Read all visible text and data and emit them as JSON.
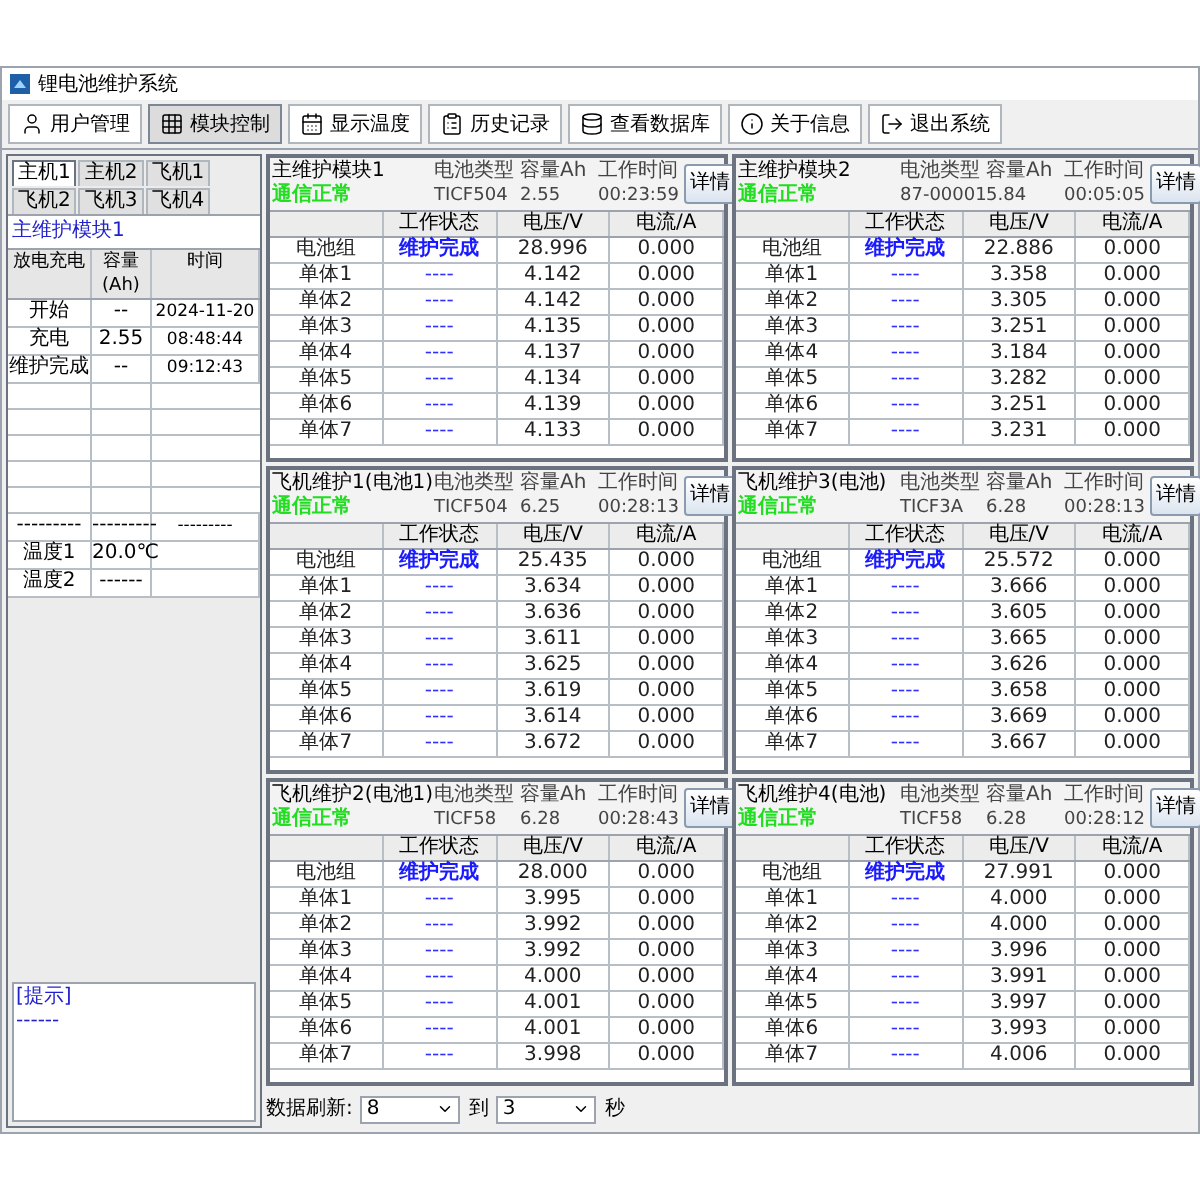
{
  "window": {
    "title": "锂电池维护系统"
  },
  "toolbar": [
    {
      "label": "用户管理",
      "selected": false
    },
    {
      "label": "模块控制",
      "selected": true
    },
    {
      "label": "显示温度",
      "selected": false
    },
    {
      "label": "历史记录",
      "selected": false
    },
    {
      "label": "查看数据库",
      "selected": false
    },
    {
      "label": "关于信息",
      "selected": false
    },
    {
      "label": "退出系统",
      "selected": false
    }
  ],
  "left_panel": {
    "tabs": [
      {
        "label": "主机1",
        "selected": true
      },
      {
        "label": "主机2",
        "selected": false
      },
      {
        "label": "飞机1",
        "selected": false
      },
      {
        "label": "飞机2",
        "selected": false
      },
      {
        "label": "飞机3",
        "selected": false
      },
      {
        "label": "飞机4",
        "selected": false
      }
    ],
    "title": "主维护模块1",
    "columns": [
      "放电充电",
      "容量(Ah)",
      "时间"
    ],
    "rows": [
      {
        "kind": "data",
        "cells": [
          "开始",
          "--",
          "2024-11-20"
        ]
      },
      {
        "kind": "data",
        "cells": [
          "充电",
          "2.55",
          "08:48:44"
        ]
      },
      {
        "kind": "data",
        "cells": [
          "维护完成",
          "--",
          "09:12:43"
        ]
      },
      {
        "kind": "blank"
      },
      {
        "kind": "blank"
      },
      {
        "kind": "blank"
      },
      {
        "kind": "blank"
      },
      {
        "kind": "blank"
      },
      {
        "kind": "data",
        "cells": [
          "---------",
          "---------",
          "---------"
        ]
      },
      {
        "kind": "data",
        "cells": [
          "温度1",
          "20.0℃"
        ]
      },
      {
        "kind": "data",
        "cells": [
          "温度2",
          "------"
        ]
      }
    ],
    "hint": {
      "title": "[提示]",
      "text": "------"
    }
  },
  "modules": [
    {
      "name": "主维护模块1",
      "status": "通信正常",
      "fields": [
        {
          "label": "电池类型",
          "value": "TICF504"
        },
        {
          "label": "容量Ah",
          "value": "2.55"
        },
        {
          "label": "工作时间",
          "value": "00:23:59"
        }
      ],
      "button": "详情",
      "columns": [
        "",
        "工作状态",
        "电压/V",
        "电流/A"
      ],
      "rows": [
        [
          "电池组",
          "维护完成",
          "28.996",
          "0.000"
        ],
        [
          "单体1",
          "----",
          "4.142",
          "0.000"
        ],
        [
          "单体2",
          "----",
          "4.142",
          "0.000"
        ],
        [
          "单体3",
          "----",
          "4.135",
          "0.000"
        ],
        [
          "单体4",
          "----",
          "4.137",
          "0.000"
        ],
        [
          "单体5",
          "----",
          "4.134",
          "0.000"
        ],
        [
          "单体6",
          "----",
          "4.139",
          "0.000"
        ],
        [
          "单体7",
          "----",
          "4.133",
          "0.000"
        ]
      ]
    },
    {
      "name": "主维护模块2",
      "status": "通信正常",
      "fields": [
        {
          "label": "电池类型",
          "value": "87-00001"
        },
        {
          "label": "容量Ah",
          "value": "5.84"
        },
        {
          "label": "工作时间",
          "value": "00:05:05"
        }
      ],
      "button": "详情",
      "columns": [
        "",
        "工作状态",
        "电压/V",
        "电流/A"
      ],
      "rows": [
        [
          "电池组",
          "维护完成",
          "22.886",
          "0.000"
        ],
        [
          "单体1",
          "----",
          "3.358",
          "0.000"
        ],
        [
          "单体2",
          "----",
          "3.305",
          "0.000"
        ],
        [
          "单体3",
          "----",
          "3.251",
          "0.000"
        ],
        [
          "单体4",
          "----",
          "3.184",
          "0.000"
        ],
        [
          "单体5",
          "----",
          "3.282",
          "0.000"
        ],
        [
          "单体6",
          "----",
          "3.251",
          "0.000"
        ],
        [
          "单体7",
          "----",
          "3.231",
          "0.000"
        ]
      ]
    },
    {
      "name": "飞机维护1(电池1)",
      "status": "通信正常",
      "fields": [
        {
          "label": "电池类型",
          "value": "TICF504"
        },
        {
          "label": "容量Ah",
          "value": "6.25"
        },
        {
          "label": "工作时间",
          "value": "00:28:13"
        }
      ],
      "button": "详情",
      "columns": [
        "",
        "工作状态",
        "电压/V",
        "电流/A"
      ],
      "rows": [
        [
          "电池组",
          "维护完成",
          "25.435",
          "0.000"
        ],
        [
          "单体1",
          "----",
          "3.634",
          "0.000"
        ],
        [
          "单体2",
          "----",
          "3.636",
          "0.000"
        ],
        [
          "单体3",
          "----",
          "3.611",
          "0.000"
        ],
        [
          "单体4",
          "----",
          "3.625",
          "0.000"
        ],
        [
          "单体5",
          "----",
          "3.619",
          "0.000"
        ],
        [
          "单体6",
          "----",
          "3.614",
          "0.000"
        ],
        [
          "单体7",
          "----",
          "3.672",
          "0.000"
        ]
      ]
    },
    {
      "name": "飞机维护3(电池)",
      "status": "通信正常",
      "fields": [
        {
          "label": "电池类型",
          "value": "TICF3A"
        },
        {
          "label": "容量Ah",
          "value": "6.28"
        },
        {
          "label": "工作时间",
          "value": "00:28:13"
        }
      ],
      "button": "详情",
      "columns": [
        "",
        "工作状态",
        "电压/V",
        "电流/A"
      ],
      "rows": [
        [
          "电池组",
          "维护完成",
          "25.572",
          "0.000"
        ],
        [
          "单体1",
          "----",
          "3.666",
          "0.000"
        ],
        [
          "单体2",
          "----",
          "3.605",
          "0.000"
        ],
        [
          "单体3",
          "----",
          "3.665",
          "0.000"
        ],
        [
          "单体4",
          "----",
          "3.626",
          "0.000"
        ],
        [
          "单体5",
          "----",
          "3.658",
          "0.000"
        ],
        [
          "单体6",
          "----",
          "3.669",
          "0.000"
        ],
        [
          "单体7",
          "----",
          "3.667",
          "0.000"
        ]
      ]
    },
    {
      "name": "飞机维护2(电池1)",
      "status": "通信正常",
      "fields": [
        {
          "label": "电池类型",
          "value": "TICF58"
        },
        {
          "label": "容量Ah",
          "value": "6.28"
        },
        {
          "label": "工作时间",
          "value": "00:28:43"
        }
      ],
      "button": "详情",
      "columns": [
        "",
        "工作状态",
        "电压/V",
        "电流/A"
      ],
      "rows": [
        [
          "电池组",
          "维护完成",
          "28.000",
          "0.000"
        ],
        [
          "单体1",
          "----",
          "3.995",
          "0.000"
        ],
        [
          "单体2",
          "----",
          "3.992",
          "0.000"
        ],
        [
          "单体3",
          "----",
          "3.992",
          "0.000"
        ],
        [
          "单体4",
          "----",
          "4.000",
          "0.000"
        ],
        [
          "单体5",
          "----",
          "4.001",
          "0.000"
        ],
        [
          "单体6",
          "----",
          "4.001",
          "0.000"
        ],
        [
          "单体7",
          "----",
          "3.998",
          "0.000"
        ]
      ]
    },
    {
      "name": "飞机维护4(电池)",
      "status": "通信正常",
      "fields": [
        {
          "label": "电池类型",
          "value": "TICF58"
        },
        {
          "label": "容量Ah",
          "value": "6.28"
        },
        {
          "label": "工作时间",
          "value": "00:28:12"
        }
      ],
      "button": "详情",
      "columns": [
        "",
        "工作状态",
        "电压/V",
        "电流/A"
      ],
      "rows": [
        [
          "电池组",
          "维护完成",
          "27.991",
          "0.000"
        ],
        [
          "单体1",
          "----",
          "4.000",
          "0.000"
        ],
        [
          "单体2",
          "----",
          "4.000",
          "0.000"
        ],
        [
          "单体3",
          "----",
          "3.996",
          "0.000"
        ],
        [
          "单体4",
          "----",
          "3.991",
          "0.000"
        ],
        [
          "单体5",
          "----",
          "3.997",
          "0.000"
        ],
        [
          "单体6",
          "----",
          "3.993",
          "0.000"
        ],
        [
          "单体7",
          "----",
          "4.006",
          "0.000"
        ]
      ]
    }
  ],
  "refresh": {
    "label": "数据刷新:",
    "from": "8",
    "to_label": "到",
    "to": "3",
    "unit": "秒"
  }
}
